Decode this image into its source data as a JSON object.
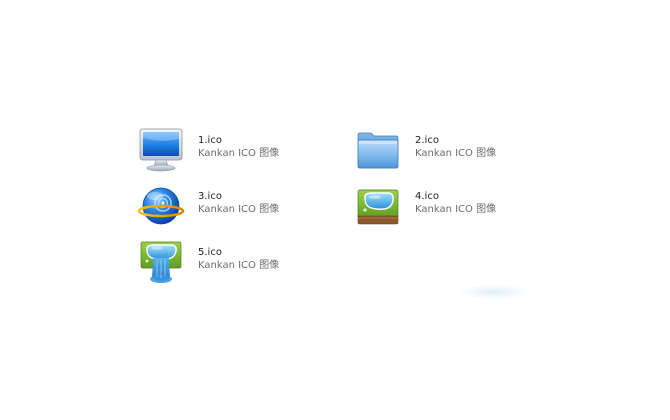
{
  "files": [
    {
      "name": "1.ico",
      "type": "Kankan ICO 图像",
      "icon": "monitor-icon"
    },
    {
      "name": "2.ico",
      "type": "Kankan ICO 图像",
      "icon": "folder-icon"
    },
    {
      "name": "3.ico",
      "type": "Kankan ICO 图像",
      "icon": "globe-icon"
    },
    {
      "name": "4.ico",
      "type": "Kankan ICO 图像",
      "icon": "lake-tile-icon"
    },
    {
      "name": "5.ico",
      "type": "Kankan ICO 图像",
      "icon": "lake-waterfall-icon"
    }
  ],
  "colors": {
    "name_text": "#1e1e1e",
    "type_text": "#6d6d6d",
    "icon_blue": "#1d7ed8",
    "icon_green": "#7cbf3a"
  }
}
